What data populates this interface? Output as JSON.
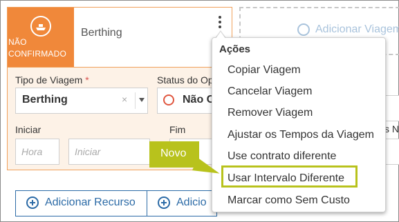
{
  "card": {
    "status_label_line1": "NÃO",
    "status_label_line2": "CONFIRMADO",
    "status_icon": "ship-icon",
    "title": "Berthing",
    "more_icon": "vertical-dots-icon",
    "trip_type_label": "Tipo de Viagem",
    "required_mark": "*",
    "trip_type_value": "Berthing",
    "clear_glyph": "×",
    "status_label": "Status do Op",
    "status_value": "Não C",
    "start_label": "Iniciar",
    "end_label": "Fim",
    "hour_placeholder": "Hora",
    "start_placeholder": "Iniciar",
    "extra_label": "s N"
  },
  "actions": {
    "add_resource": "Adicionar Recurso",
    "add_second": "Adicio",
    "add_trip": "Adicionar Viagem"
  },
  "menu": {
    "title": "Ações",
    "items": [
      "Copiar Viagem",
      "Cancelar Viagem",
      "Remover Viagem",
      "Ajustar os Tempos da Viagem",
      "Use contrato diferente",
      "Usar Intervalo Diferente",
      "Marcar como Sem Custo"
    ]
  },
  "callout": {
    "text": "Novo"
  },
  "colors": {
    "accent_orange": "#f0883a",
    "callout_green": "#b8c21c",
    "link_blue": "#2b6aa6"
  }
}
